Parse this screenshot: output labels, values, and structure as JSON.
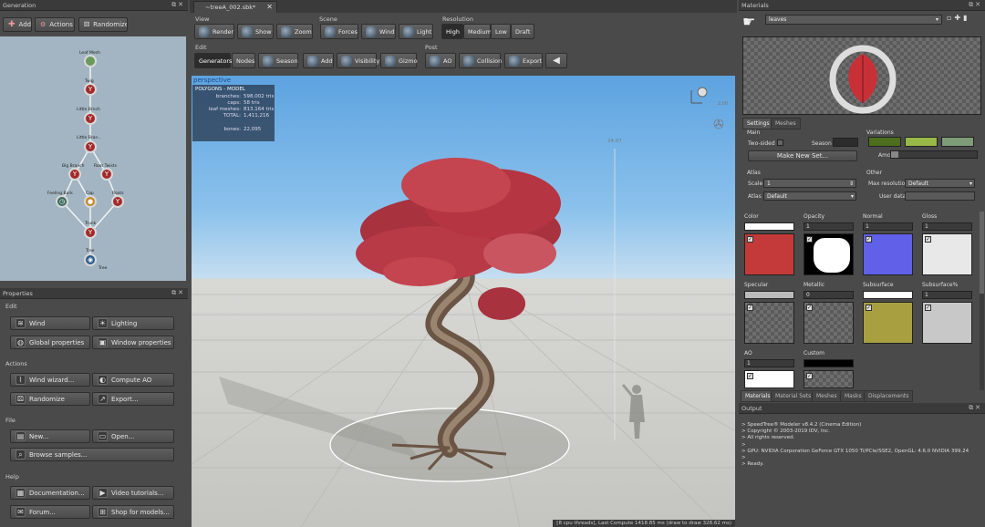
{
  "generator": {
    "title": "Generation",
    "add": "Add",
    "actions": "Actions",
    "randomize": "Randomize",
    "nodes": [
      "Leaf Mesh",
      "Twig",
      "Little Brnch",
      "Little Bran...",
      "Big Branch",
      "Root Twists",
      "Feeling Bark",
      "Cap",
      "Roots",
      "Trunk",
      "Tree",
      "Tree"
    ]
  },
  "properties": {
    "title": "Properties",
    "edit_label": "Edit",
    "wind": "Wind",
    "lighting": "Lighting",
    "global": "Global properties",
    "window": "Window properties",
    "actions_label": "Actions",
    "wind_wizard": "Wind wizard...",
    "compute_ao": "Compute AO",
    "randomize": "Randomize",
    "export": "Export...",
    "file_label": "File",
    "new": "New...",
    "open": "Open...",
    "browse": "Browse samples...",
    "help_label": "Help",
    "documentation": "Documentation...",
    "video": "Video tutorials...",
    "forum": "Forum...",
    "shop": "Shop for models..."
  },
  "doc": {
    "tab": "~treeA_002.sbk*",
    "close": "✕"
  },
  "toolbar": {
    "view_label": "View",
    "render": "Render",
    "show": "Show",
    "zoom": "Zoom",
    "scene_label": "Scene",
    "forces": "Forces",
    "wind": "Wind",
    "light": "Light",
    "resolution_label": "Resolution",
    "high": "High",
    "medium": "Medium",
    "low": "Low",
    "draft": "Draft",
    "edit_label": "Edit",
    "generators": "Generators",
    "nodes": "Nodes",
    "season": "Season",
    "add": "Add",
    "visibility": "Visibility",
    "gizmo": "Gizmo",
    "post_label": "Post",
    "ao": "AO",
    "collision": "Collision",
    "export": "Export"
  },
  "viewport": {
    "camera": "perspective",
    "stats_title": "POLYGONS - MODEL",
    "stats": [
      {
        "k": "branches:",
        "v": "598,002 tris"
      },
      {
        "k": "caps:",
        "v": "58 tris"
      },
      {
        "k": "leaf meshes:",
        "v": "813,164 tris"
      },
      {
        "k": "TOTAL:",
        "v": "1,411,216"
      },
      {
        "k": "bones:",
        "v": "22,095"
      }
    ],
    "height": "24.07",
    "gizmo_val": "2.00",
    "status": "[8 cpu threads], Last Compute 1418.85 ms (draw to draw 328.62 ms)"
  },
  "materials": {
    "title": "Materials",
    "name": "leaves",
    "tabs_top": [
      "Settings",
      "Meshes"
    ],
    "main_label": "Main",
    "two_sided": "Two-sided",
    "season": "Season",
    "make_new_set": "Make New Set...",
    "variations_label": "Variations",
    "amount": "Amount",
    "atlas_label": "Atlas",
    "scale_label": "Scale",
    "scale_val": "1",
    "atlas_field": "Atlas",
    "atlas_val": "Default",
    "other_label": "Other",
    "max_res": "Max resolution",
    "max_res_val": "Default",
    "user_data": "User data",
    "channels": [
      {
        "name": "Color",
        "val": ""
      },
      {
        "name": "Opacity",
        "val": "1"
      },
      {
        "name": "Normal",
        "val": "1"
      },
      {
        "name": "Gloss",
        "val": "1"
      },
      {
        "name": "Specular",
        "val": ""
      },
      {
        "name": "Metallic",
        "val": "0"
      },
      {
        "name": "Subsurface",
        "val": ""
      },
      {
        "name": "Subsurface%",
        "val": "1"
      },
      {
        "name": "AO",
        "val": "1"
      },
      {
        "name": "Custom",
        "val": ""
      }
    ],
    "tabs_bottom": [
      "Materials",
      "Material Sets",
      "Meshes",
      "Masks",
      "Displacements"
    ]
  },
  "output": {
    "title": "Output",
    "lines": [
      "> SpeedTree® Modeler v8.4.2 (Cinema Edition)",
      "> Copyright © 2003-2019 IDV, Inc.",
      "> All rights reserved.",
      ">",
      "> GPU: NVIDIA Corporation GeForce GTX 1050 Ti/PCIe/SSE2, OpenGL: 4.6.0 NVIDIA 399.24",
      ">",
      "> Ready."
    ]
  }
}
